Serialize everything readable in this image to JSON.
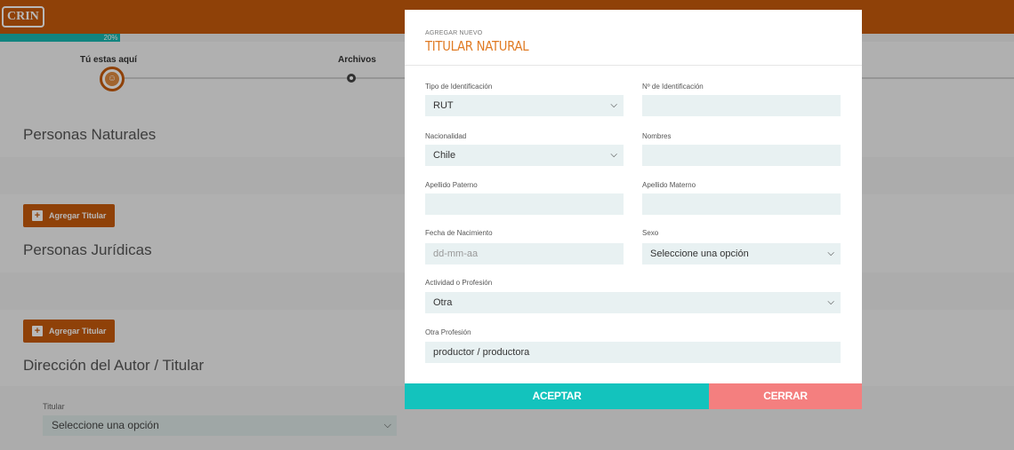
{
  "app": {
    "logo_text": "CRIN"
  },
  "progress": {
    "percent": 20,
    "label": "20%"
  },
  "steps": {
    "current_label": "Tú estas aquí",
    "next_label": "Archivos",
    "current_icon": "user-icon"
  },
  "sections": {
    "natural_title": "Personas Naturales",
    "juridica_title": "Personas Jurídicas",
    "direccion_title": "Dirección del Autor / Titular",
    "add_button_label": "Agregar Titular"
  },
  "direccion": {
    "titular_label": "Titular",
    "titular_value": "Seleccione una opción"
  },
  "modal": {
    "subtitle": "AGREGAR NUEVO",
    "title": "TITULAR NATURAL",
    "fields": {
      "tipo_id": {
        "label": "Tipo de Identificación",
        "value": "RUT"
      },
      "num_id": {
        "label": "Nº de Identificación",
        "value": ""
      },
      "nacionalidad": {
        "label": "Nacionalidad",
        "value": "Chile"
      },
      "nombres": {
        "label": "Nombres",
        "value": ""
      },
      "apellido_paterno": {
        "label": "Apellido Paterno",
        "value": ""
      },
      "apellido_materno": {
        "label": "Apellido Materno",
        "value": ""
      },
      "fecha_nac": {
        "label": "Fecha de Nacimiento",
        "placeholder": "dd-mm-aa"
      },
      "sexo": {
        "label": "Sexo",
        "value": "Seleccione una opción"
      },
      "actividad": {
        "label": "Actividad o Profesión",
        "value": "Otra"
      },
      "otra_profesion": {
        "label": "Otra Profesión",
        "value": "productor / productora"
      }
    },
    "accept_label": "ACEPTAR",
    "close_label": "CERRAR"
  },
  "colors": {
    "brand": "#c65a0c",
    "accent": "#e07b24",
    "teal": "#13c3bd",
    "coral": "#f47f7f"
  }
}
